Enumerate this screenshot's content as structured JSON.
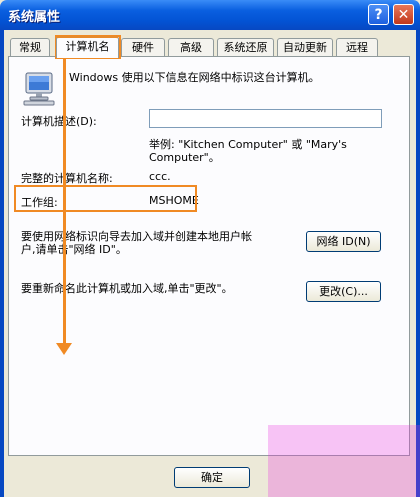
{
  "window": {
    "title": "系统属性",
    "help_label": "?",
    "close_label": "✕"
  },
  "tabs": [
    {
      "label": "常规",
      "active": false
    },
    {
      "label": "计算机名",
      "active": true
    },
    {
      "label": "硬件",
      "active": false
    },
    {
      "label": "高级",
      "active": false
    },
    {
      "label": "系统还原",
      "active": false
    },
    {
      "label": "自动更新",
      "active": false
    },
    {
      "label": "远程",
      "active": false
    }
  ],
  "content": {
    "intro_text": "Windows 使用以下信息在网络中标识这台计算机。",
    "description_label": "计算机描述(D):",
    "description_value": "",
    "example_line1": "举例: \"Kitchen Computer\" 或 \"Mary's",
    "example_line2": "Computer\"。",
    "full_name_label": "完整的计算机名称:",
    "full_name_value": "ccc.",
    "workgroup_label": "工作组:",
    "workgroup_value": "MSHOME",
    "network_id_text_line1": "要使用网络标识向导去加入域并创建本地用户帐",
    "network_id_text_line2": "户,请单击\"网络 ID\"。",
    "network_id_button": "网络 ID(N)",
    "rename_text": "要重新命名此计算机或加入域,单击\"更改\"。",
    "change_button": "更改(C)..."
  },
  "footer": {
    "ok_button": "确定"
  },
  "icons": {
    "monitor": "computer-monitor-icon"
  },
  "colors": {
    "highlight": "#f08a24",
    "titlebar": "#0353d4"
  }
}
